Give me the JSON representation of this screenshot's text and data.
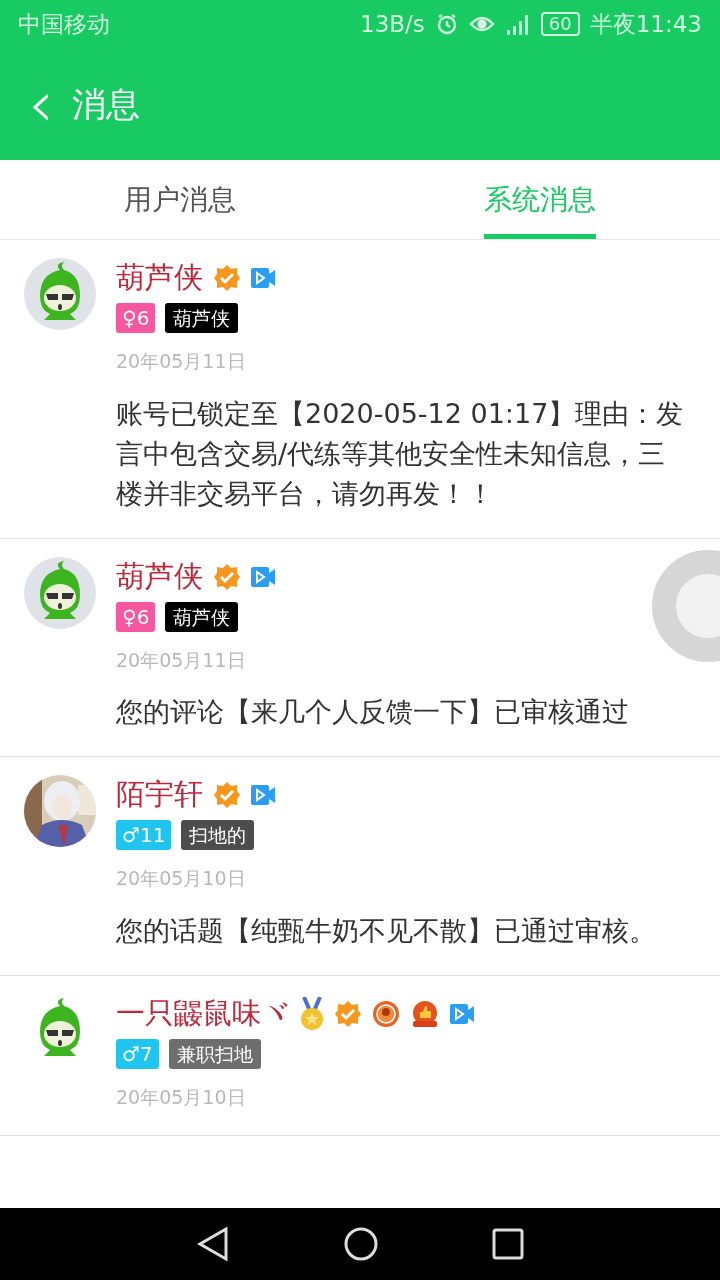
{
  "status_bar": {
    "carrier": "中国移动",
    "speed": "13B/s",
    "battery": "60",
    "time": "半夜11:43"
  },
  "header": {
    "back_icon": "‹",
    "title": "消息"
  },
  "tabs": [
    {
      "label": "用户消息",
      "selected": false
    },
    {
      "label": "系统消息",
      "selected": true
    }
  ],
  "messages": [
    {
      "avatar": {
        "kind": "gourd_framed"
      },
      "name": "葫芦侠",
      "badges": [
        {
          "kind": "verified"
        },
        {
          "kind": "video"
        }
      ],
      "gender_badge": {
        "kind": "female",
        "text": "♀6"
      },
      "tag": {
        "label": "葫芦侠",
        "color": "#000000"
      },
      "date": "20年05月11日",
      "body": "账号已锁定至【2020-05-12 01:17】理由：发言中包含交易/代练等其他安全性未知信息，三楼并非交易平台，请勿再发！！"
    },
    {
      "avatar": {
        "kind": "gourd_framed"
      },
      "name": "葫芦侠",
      "badges": [
        {
          "kind": "verified"
        },
        {
          "kind": "video"
        }
      ],
      "gender_badge": {
        "kind": "female",
        "text": "♀6"
      },
      "tag": {
        "label": "葫芦侠",
        "color": "#000000"
      },
      "date": "20年05月11日",
      "body": "您的评论【来几个人反馈一下】已审核通过"
    },
    {
      "name": "陌宇轩",
      "badges": [
        {
          "kind": "verified"
        },
        {
          "kind": "video"
        }
      ],
      "gender_badge": {
        "kind": "male",
        "text": "♂11"
      },
      "tag": {
        "label": "扫地的",
        "color": "#4d4d4d"
      },
      "date": "20年05月10日",
      "body": "您的话题【纯甄牛奶不见不散】已通过审核。"
    },
    {
      "avatar": {
        "kind": "gourd"
      },
      "name": "一只鼹鼠味ヾ",
      "badges": [
        {
          "kind": "medal"
        },
        {
          "kind": "verified"
        },
        {
          "kind": "rank"
        },
        {
          "kind": "thumb"
        },
        {
          "kind": "video"
        }
      ],
      "gender_badge": {
        "kind": "male",
        "text": "♂7"
      },
      "tag": {
        "label": "兼职扫地",
        "color": "#6e6e6e"
      },
      "date": "20年05月10日"
    }
  ]
}
